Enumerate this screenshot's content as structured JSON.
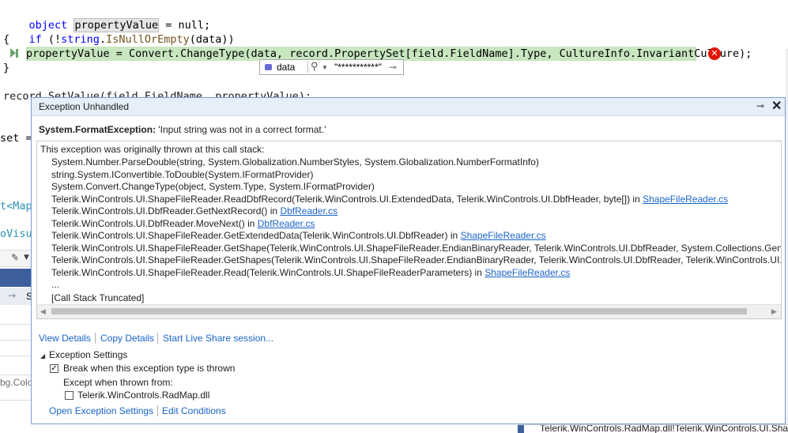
{
  "code": {
    "line1": {
      "t1": "object",
      "t2": " ",
      "var": "propertyValue",
      "t3": " = null;"
    },
    "line2": {
      "kw": "if",
      "t1": " (!",
      "kw2": "string",
      "t2": ".",
      "method": "IsNullOrEmpty",
      "t3": "(data))"
    },
    "line3": "{",
    "line4": "propertyValue = Convert.ChangeType(data, record.PropertySet[field.FieldName].Type, CultureInfo.InvariantCulture);",
    "line5": "}",
    "line6": "record.SetValue(field.FieldName, propertyValue);",
    "clip_set": "set =",
    "clip_map": "t<MapV",
    "clip_visual": "oVisua",
    "clip_s": "S",
    "clip_bgcolor": "bg.Colo"
  },
  "datatip": {
    "name": "data",
    "value": "\"***********\""
  },
  "exception": {
    "title": "Exception Unhandled",
    "type": "System.FormatException:",
    "message": " 'Input string was not in a correct format.'",
    "intro": "This exception was originally thrown at this call stack:",
    "stack": [
      {
        "text": "System.Number.ParseDouble(string, System.Globalization.NumberStyles, System.Globalization.NumberFormatInfo)",
        "in": "",
        "file": ""
      },
      {
        "text": "string.System.IConvertible.ToDouble(System.IFormatProvider)",
        "in": "",
        "file": ""
      },
      {
        "text": "System.Convert.ChangeType(object, System.Type, System.IFormatProvider)",
        "in": "",
        "file": ""
      },
      {
        "text": "Telerik.WinControls.UI.ShapeFileReader.ReadDbfRecord(Telerik.WinControls.UI.ExtendedData, Telerik.WinControls.UI.DbfHeader, byte[])",
        "in": " in ",
        "file": "ShapeFileReader.cs"
      },
      {
        "text": "Telerik.WinControls.UI.DbfReader.GetNextRecord()",
        "in": " in ",
        "file": "DbfReader.cs"
      },
      {
        "text": "Telerik.WinControls.UI.DbfReader.MoveNext()",
        "in": " in ",
        "file": "DbfReader.cs"
      },
      {
        "text": "Telerik.WinControls.UI.ShapeFileReader.GetExtendedData(Telerik.WinControls.UI.DbfReader)",
        "in": " in ",
        "file": "ShapeFileReader.cs"
      },
      {
        "text": "Telerik.WinControls.UI.ShapeFileReader.GetShape(Telerik.WinControls.UI.ShapeFileReader.EndianBinaryReader, Telerik.WinControls.UI.DbfReader, System.Collections.Generic.List",
        "in": "",
        "file": ""
      },
      {
        "text": "Telerik.WinControls.UI.ShapeFileReader.GetShapes(Telerik.WinControls.UI.ShapeFileReader.EndianBinaryReader, Telerik.WinControls.UI.DbfReader, Telerik.WinControls.UI.ShapeF",
        "in": "",
        "file": ""
      },
      {
        "text": "Telerik.WinControls.UI.ShapeFileReader.Read(Telerik.WinControls.UI.ShapeFileReaderParameters)",
        "in": " in ",
        "file": "ShapeFileReader.cs"
      }
    ],
    "ellipsis": "...",
    "truncated": "[Call Stack Truncated]",
    "view_details": "View Details",
    "copy_details": "Copy Details",
    "live_share": "Start Live Share session...",
    "settings_heading": "Exception Settings",
    "break_label": "Break when this exception type is thrown",
    "break_checked": true,
    "except_label": "Except when thrown from:",
    "dll_label": "Telerik.WinControls.RadMap.dll",
    "dll_checked": false,
    "open_settings": "Open Exception Settings",
    "edit_conditions": "Edit Conditions"
  },
  "bottom_status": "Telerik.WinControls.RadMap.dll!Telerik.WinControls.UI.Shap",
  "colors": {
    "error": "#e51400",
    "exec_highlight": "#c8e6c0",
    "link": "#1a64c8",
    "panel_header": "#e6eef9"
  }
}
